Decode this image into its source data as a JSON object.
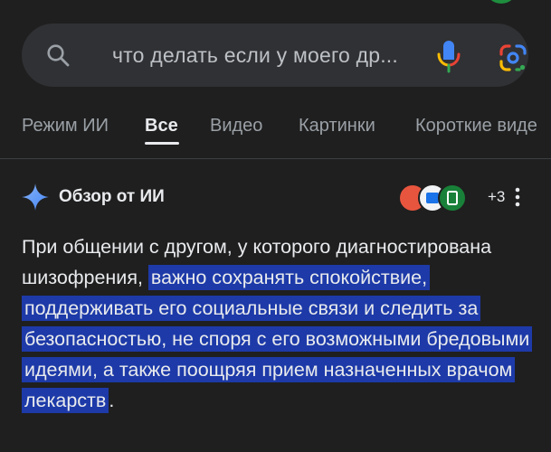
{
  "search": {
    "query": "что делать если у моего др..."
  },
  "tabs": [
    {
      "label": "Режим ИИ"
    },
    {
      "label": "Все"
    },
    {
      "label": "Видео"
    },
    {
      "label": "Картинки"
    },
    {
      "label": "Короткие виде"
    }
  ],
  "overview": {
    "title": "Обзор от ИИ",
    "sources_more": "+3",
    "text_plain_before": "При общении с другом, у которого диагностирована шизофрения, ",
    "text_highlighted": "важно сохранять спокойствие, поддерживать его социальные связи и следить за безопасностью, не споря с его возможными бредовыми идеями, а также поощряя прием назначенных врачом лекарств",
    "text_plain_after": "."
  },
  "colors": {
    "background": "#1f1f1f",
    "search_bar": "#303134",
    "highlight": "#1d3aa8",
    "tab_active": "#e8eaed",
    "tab_inactive": "#9aa0a6"
  },
  "icons": [
    "search-icon",
    "mic-icon",
    "google-lens-icon",
    "ai-sparkle-icon",
    "kebab-menu-icon"
  ]
}
